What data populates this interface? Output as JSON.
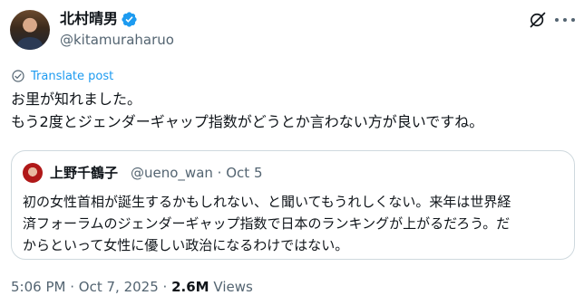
{
  "author": {
    "name": "北村晴男",
    "handle": "@kitamuraharuo",
    "verified": true
  },
  "translate_label": "Translate post",
  "tweet_lines": [
    "お里が知れました。",
    "もう2度とジェンダーギャップ指数がどうとか言わない方が良いですね。"
  ],
  "quote": {
    "name": "上野千鶴子",
    "handle": "@ueno_wan",
    "separator": "·",
    "date": "Oct 5",
    "lines": [
      "初の女性首相が誕生するかもしれない、と聞いてもうれしくない。来年は世界経",
      "済フォーラムのジェンダーギャップ指数で日本のランキングが上がるだろう。だ",
      "からといって女性に優しい政治になるわけではない。"
    ]
  },
  "meta": {
    "time": "5:06 PM",
    "separator": "·",
    "date": "Oct 7, 2025",
    "views_count": "2.6M",
    "views_label": "Views"
  },
  "colors": {
    "link": "#1d9bf0",
    "secondary_text": "#536471",
    "border": "#cfd9de"
  },
  "icons": [
    "verified-badge-icon",
    "grok-icon",
    "more-icon",
    "translate-icon"
  ]
}
